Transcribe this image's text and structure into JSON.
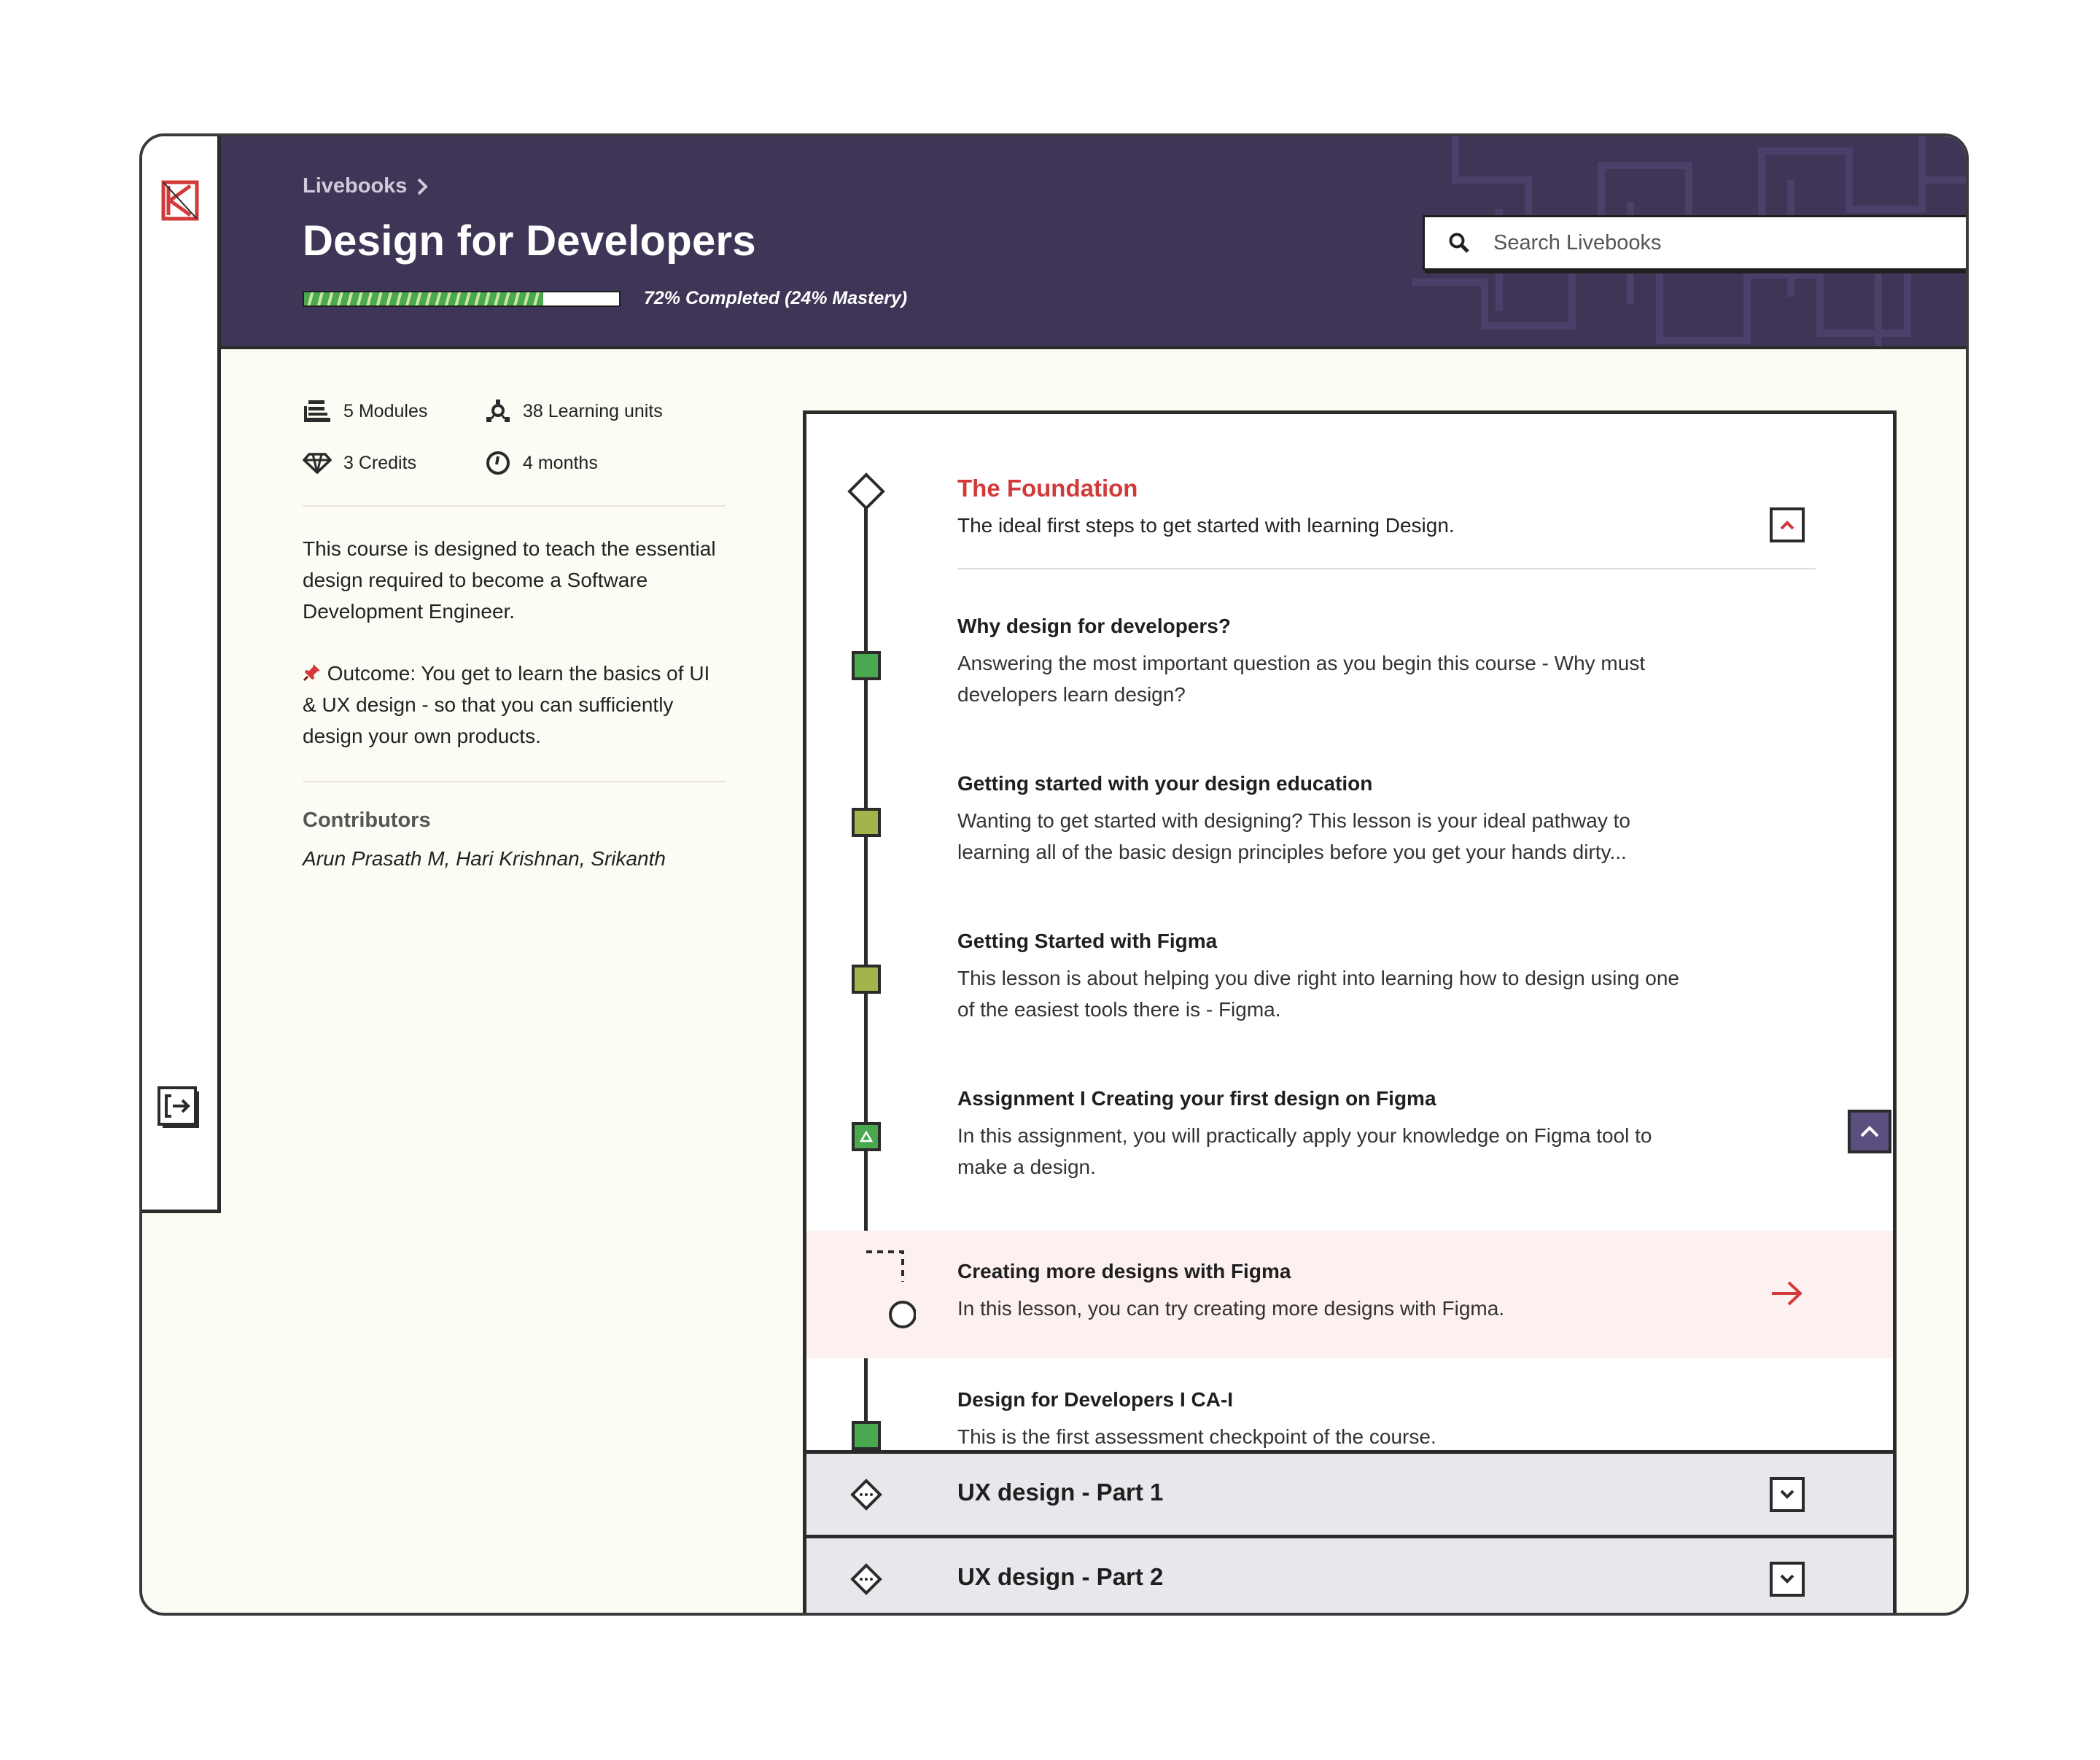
{
  "header": {
    "breadcrumb": "Livebooks",
    "title": "Design for Developers",
    "progress_text": "72% Completed (24% Mastery)",
    "progress_fraction": 0.76
  },
  "search": {
    "placeholder": "Search Livebooks"
  },
  "stats": [
    {
      "icon": "modules-icon",
      "label": "5 Modules"
    },
    {
      "icon": "learning-units-icon",
      "label": "38 Learning units"
    },
    {
      "icon": "diamond-icon",
      "label": "3 Credits"
    },
    {
      "icon": "clock-icon",
      "label": "4 months"
    }
  ],
  "description": "This course is designed to teach the essential design required to become a Software Development Engineer.",
  "outcome": "Outcome: You get to learn the basics of UI & UX design - so that you can sufficiently design your own products.",
  "contributors": {
    "title": "Contributors",
    "names": "Arun Prasath M, Hari Krishnan, Srikanth"
  },
  "module": {
    "title": "The Foundation",
    "subtitle": "The ideal first steps to get started with learning Design."
  },
  "lessons": [
    {
      "title": "Why design for developers?",
      "desc": "Answering the most important question as you begin this course - Why must developers learn design?",
      "status": "completed"
    },
    {
      "title": "Getting started with your design education",
      "desc": "Wanting to get started with designing? This lesson is your ideal pathway to learning all of the basic design principles before you get your hands dirty...",
      "status": "partial"
    },
    {
      "title": "Getting Started with Figma",
      "desc": "This lesson is about helping you dive right into learning how to design using one of the easiest tools there is - Figma.",
      "status": "partial"
    },
    {
      "title": "Assignment I Creating your first design on Figma",
      "desc": "In this assignment, you will practically apply your knowledge on Figma tool to make a design.",
      "status": "assignment"
    },
    {
      "title": "Creating more designs with Figma",
      "desc": "In this lesson, you can try creating more designs with Figma.",
      "status": "current"
    },
    {
      "title": "Design for Developers I CA-I",
      "desc": "This is the first assessment checkpoint of the course.",
      "status": "completed"
    }
  ],
  "sections": [
    {
      "label": "UX design - Part 1"
    },
    {
      "label": "UX design - Part 2"
    }
  ],
  "colors": {
    "header_bg": "#3f3556",
    "accent_red": "#d23a3a",
    "complete_green": "#4aa84f",
    "partial_olive": "#a5b44a",
    "page_bg": "#fcfcf4"
  }
}
